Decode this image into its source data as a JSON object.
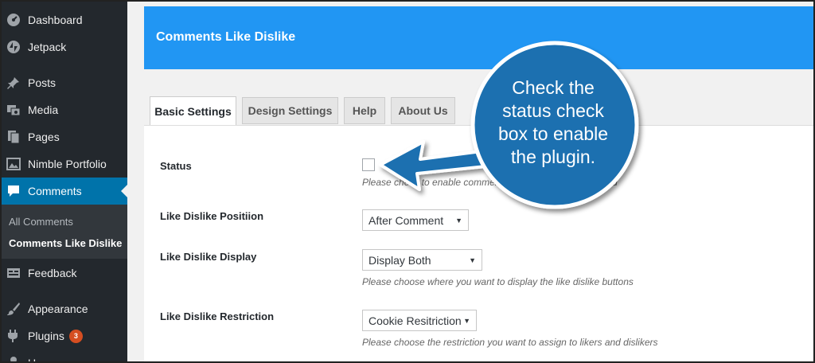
{
  "sidebar": {
    "items": [
      {
        "label": "Dashboard",
        "icon": "dashboard-icon"
      },
      {
        "label": "Jetpack",
        "icon": "jetpack-icon"
      },
      {
        "label": "Posts",
        "icon": "pin-icon"
      },
      {
        "label": "Media",
        "icon": "media-icon"
      },
      {
        "label": "Pages",
        "icon": "pages-icon"
      },
      {
        "label": "Nimble Portfolio",
        "icon": "portfolio-icon"
      },
      {
        "label": "Comments",
        "icon": "comment-icon",
        "active": true
      },
      {
        "label": "Feedback",
        "icon": "feedback-icon"
      },
      {
        "label": "Appearance",
        "icon": "brush-icon"
      },
      {
        "label": "Plugins",
        "icon": "plugin-icon",
        "badge": "3"
      },
      {
        "label": "U",
        "icon": "users-icon"
      }
    ],
    "submenu": [
      {
        "label": "All Comments"
      },
      {
        "label": "Comments Like Dislike",
        "current": true
      }
    ]
  },
  "banner": {
    "title": "Comments Like Dislike"
  },
  "tabs": [
    {
      "label": "Basic Settings",
      "active": true
    },
    {
      "label": "Design Settings"
    },
    {
      "label": "Help"
    },
    {
      "label": "About Us"
    }
  ],
  "settings": {
    "status": {
      "label": "Status",
      "checked": false,
      "description": "Please check to enable comments like dislike in the frontend"
    },
    "position": {
      "label": "Like Dislike Positiion",
      "value": "After Comment"
    },
    "display": {
      "label": "Like Dislike Display",
      "value": "Display Both",
      "description": "Please choose where you want to display the like dislike buttons"
    },
    "restriction": {
      "label": "Like Dislike Restriction",
      "value": "Cookie Resitriction",
      "description": "Please choose the restriction you want to assign to likers and dislikers"
    }
  },
  "callout": {
    "lines": [
      "Check the",
      "status check",
      "box to enable",
      "the plugin."
    ]
  },
  "colors": {
    "sidebar_bg": "#23282d",
    "active_menu": "#0073aa",
    "banner": "#2196f3",
    "callout": "#1a6fb0",
    "callout_border": "#ffffff"
  }
}
